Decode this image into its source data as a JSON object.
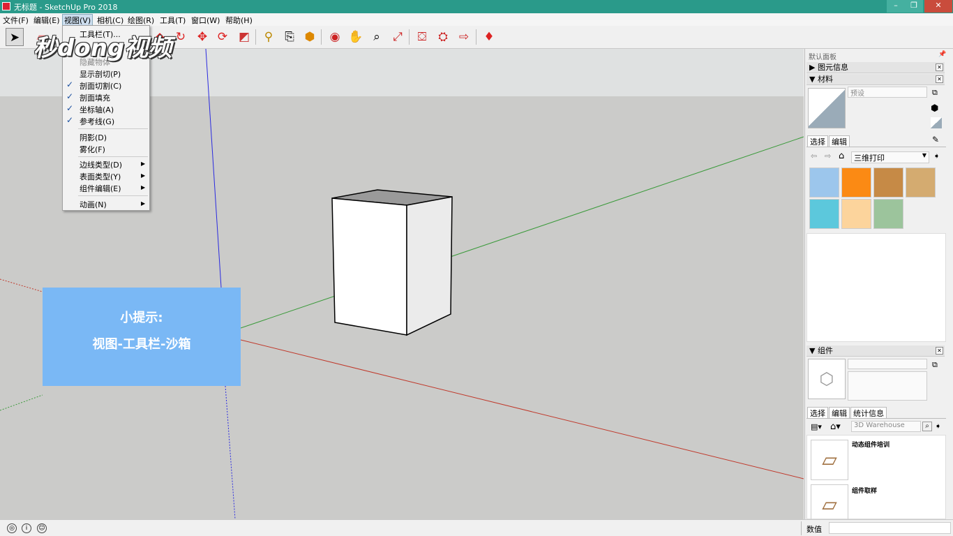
{
  "window": {
    "title": "无标题 - SketchUp Pro 2018"
  },
  "menubar": {
    "items": [
      "文件(F)",
      "编辑(E)",
      "视图(V)",
      "相机(C)",
      "绘图(R)",
      "工具(T)",
      "窗口(W)",
      "帮助(H)"
    ]
  },
  "view_menu": {
    "items": [
      {
        "label": "工具栏(T)...",
        "checked": false
      },
      {
        "label": "隐藏物体",
        "checked": false
      },
      {
        "label": "显示剖切(P)",
        "checked": false
      },
      {
        "label": "剖面切割(C)",
        "checked": true
      },
      {
        "label": "剖面填充",
        "checked": true
      },
      {
        "label": "坐标轴(A)",
        "checked": true
      },
      {
        "label": "参考线(G)",
        "checked": true
      },
      {
        "label": "阴影(D)",
        "checked": false
      },
      {
        "label": "雾化(F)",
        "checked": false
      },
      {
        "label": "边线类型(D)",
        "submenu": true
      },
      {
        "label": "表面类型(Y)",
        "submenu": true
      },
      {
        "label": "组件编辑(E)",
        "submenu": true
      },
      {
        "label": "动画(N)",
        "submenu": true
      }
    ]
  },
  "watermark": "秒dong视频",
  "hint": {
    "line1": "小提示:",
    "line2": "视图-工具栏-沙箱"
  },
  "tray": {
    "title": "默认面板",
    "entity_info": "图元信息",
    "materials": {
      "title": "材料",
      "name_placeholder": "预设",
      "tabs": [
        "选择",
        "编辑"
      ],
      "library": "三维打印",
      "swatches": [
        "#9cc6ec",
        "#fb8a14",
        "#c68a46",
        "#d4ab70",
        "#5cc8dc",
        "#fcd49c",
        "#9cc49c"
      ]
    },
    "components": {
      "title": "组件",
      "tabs": [
        "选择",
        "编辑",
        "统计信息"
      ],
      "search_placeholder": "3D Warehouse",
      "items": [
        "动态组件培训",
        "组件取样"
      ]
    }
  },
  "status": {
    "measurements_label": "数值"
  },
  "colors": {
    "titlebar": "#2a9a8a",
    "hint_bg": "#7ab8f5",
    "x_axis": "#c0392b",
    "y_axis": "#3a9a3a",
    "z_axis": "#2a2ae0"
  }
}
